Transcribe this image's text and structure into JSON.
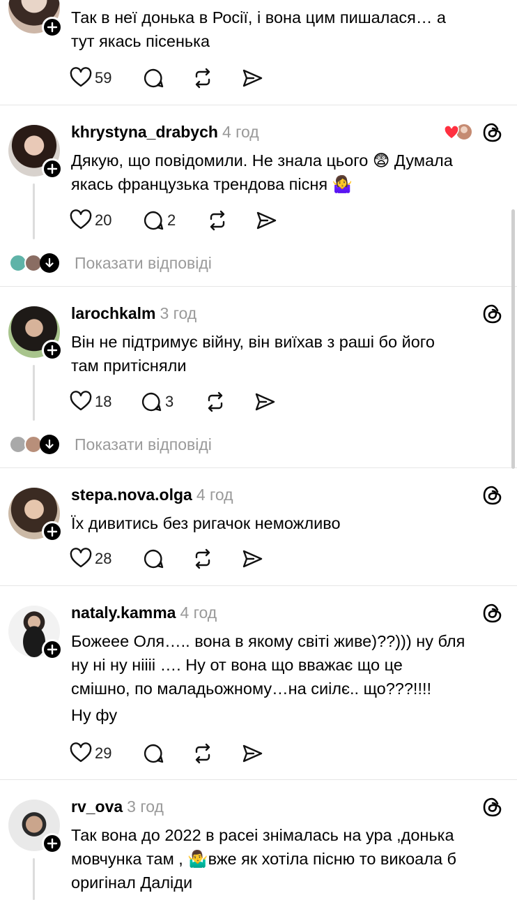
{
  "posts": [
    {
      "id": "p0",
      "username": "",
      "time": "",
      "text_lines": [
        "Так в неї донька в Росії, і вона цим пишалася… а",
        "тут якась пісенька"
      ],
      "likes": "59",
      "comments": ""
    },
    {
      "id": "p1",
      "username": "khrystyna_drabych",
      "time": "4 год",
      "text_lines": [
        "Дякую, що повідомили. Не знала цього 😨 Думала",
        "якась французька трендова пісня 🤷‍♀️"
      ],
      "likes": "20",
      "comments": "2",
      "show_replies": "Показати відповіді"
    },
    {
      "id": "p2",
      "username": "larochkalm",
      "time": "3 год",
      "text_lines": [
        "Він не підтримує війну, він виїхав з раші бо його",
        "там притісняли"
      ],
      "likes": "18",
      "comments": "3",
      "show_replies": "Показати відповіді"
    },
    {
      "id": "p3",
      "username": "stepa.nova.olga",
      "time": "4 год",
      "text_lines": [
        "Їх дивитись без ригачок неможливо"
      ],
      "likes": "28",
      "comments": ""
    },
    {
      "id": "p4",
      "username": "nataly.kamma",
      "time": "4 год",
      "text_lines": [
        "Божеее Оля….. вона в якому світі живе)??))) ну бля",
        "ну ні ну ніііі …. Ну от вона що вважає що це",
        "смішно, по маладьожному…на сиілє.. що???!!!!",
        "Ну фу"
      ],
      "likes": "29",
      "comments": ""
    },
    {
      "id": "p5",
      "username": "rv_ova",
      "time": "3 год",
      "text_lines": [
        "Так вона до 2022 в расеі знімалась на ура ,донька",
        "мовчунка там , 🤷‍♂️вже як хотіла пісню то викоала б",
        "оригінал Даліди"
      ],
      "likes": "",
      "comments": ""
    }
  ],
  "colors": {
    "text": "#000000",
    "muted": "#999999",
    "divider": "#e6e6e6",
    "heart_red": "#ff3040"
  },
  "icons": {
    "like": "heart-icon",
    "comment": "comment-bubble-icon",
    "repost": "repost-icon",
    "share": "share-send-icon",
    "threads": "threads-logo-icon",
    "follow": "plus-icon",
    "expand": "arrow-down-icon"
  }
}
